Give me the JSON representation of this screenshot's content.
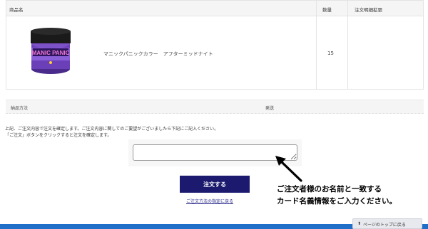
{
  "order_table": {
    "headers": {
      "product": "商品名",
      "quantity": "数量",
      "extension": "注文明細拡張"
    },
    "item": {
      "name": "マニックパニックカラー　アフターミッドナイト",
      "quantity": "15",
      "image_label": "MANIC PANIC"
    }
  },
  "delivery": {
    "label": "納品方法",
    "value": "発送"
  },
  "instruction": {
    "line1": "上記、ご注文内容で注文を確定します。ご注文内容に関してのご要望がございましたら下記にご記入ください。",
    "line2": "「ご注文」ボタンをクリックすると注文を確定します。"
  },
  "comment": {
    "value": ""
  },
  "order_button": {
    "label": "注文する"
  },
  "back_link": {
    "label": "ご注文方法の指定に戻る"
  },
  "annotation": {
    "line1": "ご注文者様のお名前と一致する",
    "line2": "カード名義情報をご入力ください。"
  },
  "page_top": {
    "icon": "up-arrow",
    "label": "ページのトップに戻る"
  },
  "colors": {
    "button": "#1c1a6e",
    "footer": "#1f6ec7",
    "product": "#6b3fb8"
  }
}
